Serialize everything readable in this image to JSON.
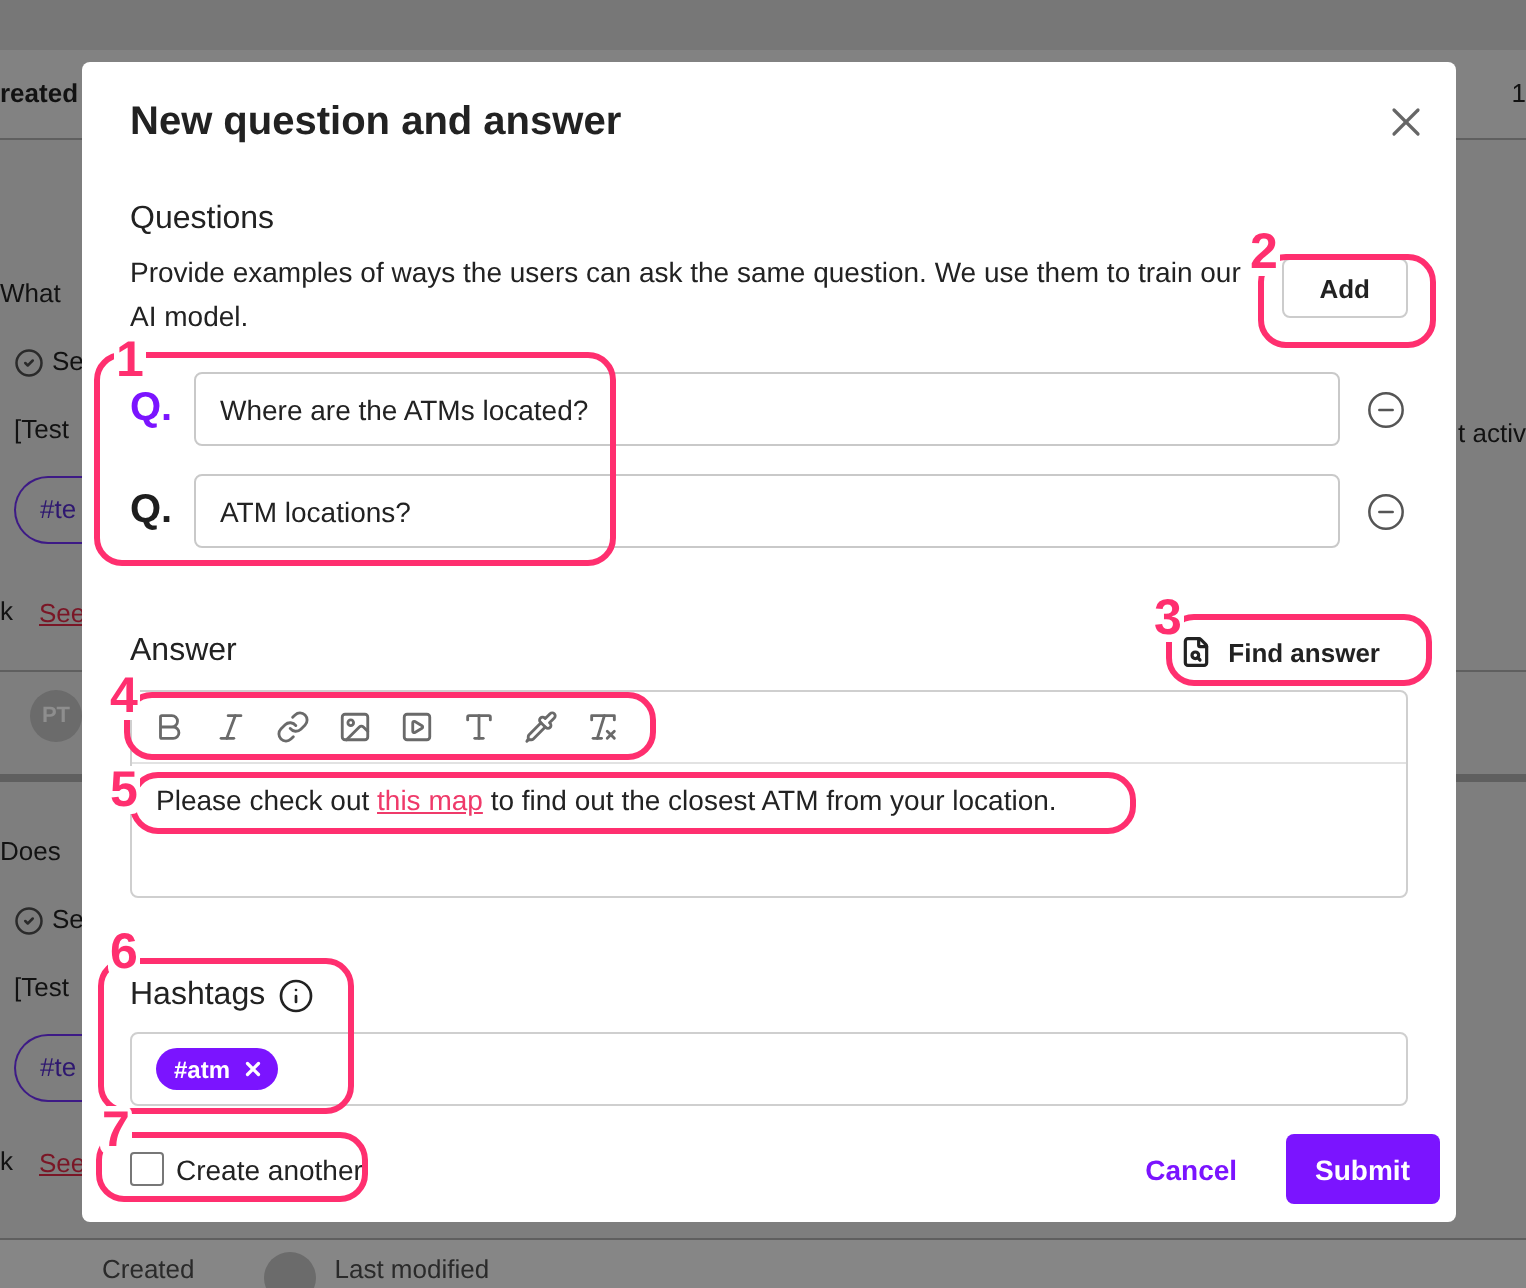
{
  "background": {
    "header": {
      "column_1": "reated",
      "column_2": "1"
    },
    "cards": [
      {
        "title": "What",
        "status": "Se",
        "text": "[Test",
        "side_text": "t activ",
        "hashtag": "#te",
        "prefix": "k",
        "link": "See",
        "avatar": "PT"
      },
      {
        "title": "Does",
        "status": "Se",
        "text": "[Test",
        "hashtag": "#te",
        "prefix": "k",
        "link": "See"
      }
    ],
    "footer": {
      "label_1": "Created",
      "label_2": "Last modified"
    }
  },
  "dialog": {
    "title": "New question and answer",
    "questions": {
      "heading": "Questions",
      "description": "Provide examples of ways the users can ask the same question. We use them to train our AI model.",
      "add_button": "Add",
      "items": [
        {
          "prefix": "Q.",
          "value": "Where are the ATMs located?",
          "active": true
        },
        {
          "prefix": "Q.",
          "value": "ATM locations?",
          "active": false
        }
      ]
    },
    "answer": {
      "heading": "Answer",
      "find_button": "Find answer",
      "text_before": "Please check out",
      "link": "this map",
      "text_after": "to find out the closest ATM from your location."
    },
    "hashtags": {
      "heading": "Hashtags",
      "tags": [
        "#atm"
      ]
    },
    "create_another": {
      "label": "Create another",
      "checked": false
    },
    "buttons": {
      "cancel": "Cancel",
      "submit": "Submit"
    }
  },
  "annotations": [
    "1",
    "2",
    "3",
    "4",
    "5",
    "6",
    "7"
  ]
}
